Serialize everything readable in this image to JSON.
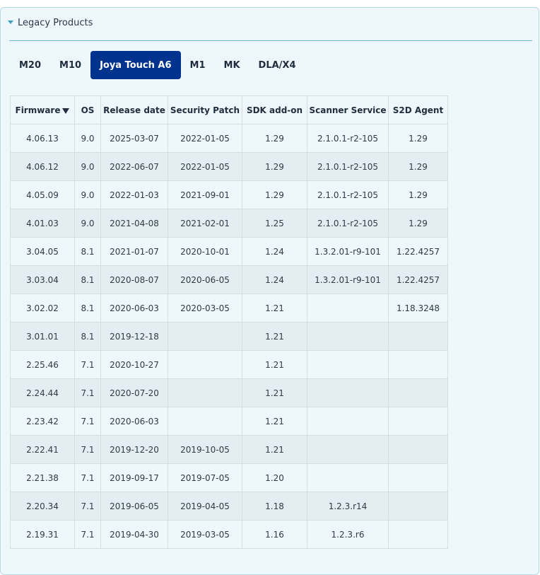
{
  "section": {
    "title": "Legacy Products"
  },
  "tabs": [
    {
      "label": "M20",
      "active": false
    },
    {
      "label": "M10",
      "active": false
    },
    {
      "label": "Joya Touch A6",
      "active": true
    },
    {
      "label": "M1",
      "active": false
    },
    {
      "label": "MK",
      "active": false
    },
    {
      "label": "DLA/X4",
      "active": false
    }
  ],
  "table": {
    "columns": [
      "Firmware",
      "OS",
      "Release date",
      "Security Patch",
      "SDK add-on",
      "Scanner Service",
      "S2D Agent"
    ],
    "sort_column": "Firmware",
    "sort_direction": "descending",
    "rows": [
      [
        "4.06.13",
        "9.0",
        "2025-03-07",
        "2022-01-05",
        "1.29",
        "2.1.0.1-r2-105",
        "1.29"
      ],
      [
        "4.06.12",
        "9.0",
        "2022-06-07",
        "2022-01-05",
        "1.29",
        "2.1.0.1-r2-105",
        "1.29"
      ],
      [
        "4.05.09",
        "9.0",
        "2022-01-03",
        "2021-09-01",
        "1.29",
        "2.1.0.1-r2-105",
        "1.29"
      ],
      [
        "4.01.03",
        "9.0",
        "2021-04-08",
        "2021-02-01",
        "1.25",
        "2.1.0.1-r2-105",
        "1.29"
      ],
      [
        "3.04.05",
        "8.1",
        "2021-01-07",
        "2020-10-01",
        "1.24",
        "1.3.2.01-r9-101",
        "1.22.4257"
      ],
      [
        "3.03.04",
        "8.1",
        "2020-08-07",
        "2020-06-05",
        "1.24",
        "1.3.2.01-r9-101",
        "1.22.4257"
      ],
      [
        "3.02.02",
        "8.1",
        "2020-06-03",
        "2020-03-05",
        "1.21",
        "",
        "1.18.3248"
      ],
      [
        "3.01.01",
        "8.1",
        "2019-12-18",
        "",
        "1.21",
        "",
        ""
      ],
      [
        "2.25.46",
        "7.1",
        "2020-10-27",
        "",
        "1.21",
        "",
        ""
      ],
      [
        "2.24.44",
        "7.1",
        "2020-07-20",
        "",
        "1.21",
        "",
        ""
      ],
      [
        "2.23.42",
        "7.1",
        "2020-06-03",
        "",
        "1.21",
        "",
        ""
      ],
      [
        "2.22.41",
        "7.1",
        "2019-12-20",
        "2019-10-05",
        "1.21",
        "",
        ""
      ],
      [
        "2.21.38",
        "7.1",
        "2019-09-17",
        "2019-07-05",
        "1.20",
        "",
        ""
      ],
      [
        "2.20.34",
        "7.1",
        "2019-06-05",
        "2019-04-05",
        "1.18",
        "1.2.3.r14",
        ""
      ],
      [
        "2.19.31",
        "7.1",
        "2019-04-30",
        "2019-03-05",
        "1.16",
        "1.2.3.r6",
        ""
      ]
    ]
  },
  "colors": {
    "accent": "#00338d",
    "panel_bg": "#eef7fc",
    "row_alt_bg": "#e4eef2",
    "rule": "#6fb6cf"
  },
  "icons": {
    "section_toggle": "caret-down-icon",
    "sort_indicator": "sort-desc-icon"
  }
}
